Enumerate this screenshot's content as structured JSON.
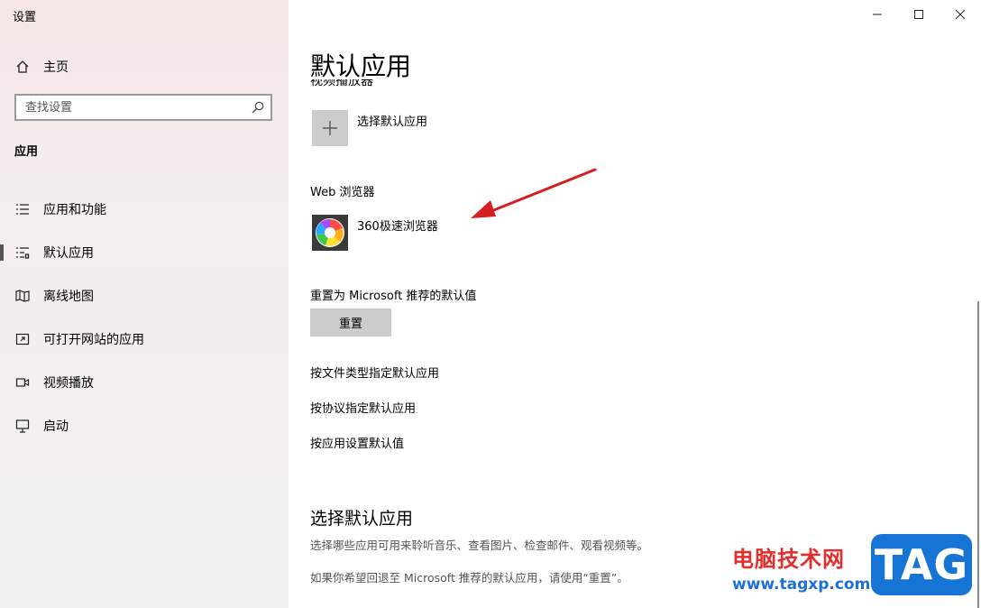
{
  "app": {
    "title": "设置"
  },
  "sidebar": {
    "home_label": "主页",
    "search_placeholder": "查找设置",
    "section_heading": "应用",
    "items": [
      {
        "label": "应用和功能",
        "icon": "list-icon"
      },
      {
        "label": "默认应用",
        "icon": "default-apps-icon",
        "selected": true
      },
      {
        "label": "离线地图",
        "icon": "map-icon"
      },
      {
        "label": "可打开网站的应用",
        "icon": "open-website-icon"
      },
      {
        "label": "视频播放",
        "icon": "video-icon"
      },
      {
        "label": "启动",
        "icon": "startup-icon"
      }
    ]
  },
  "main": {
    "title": "默认应用",
    "clipped_category": "视频播放器",
    "video_player_app": "选择默认应用",
    "web_browser_label": "Web 浏览器",
    "web_browser_app": "360极速浏览器",
    "reset_label": "重置为 Microsoft 推荐的默认值",
    "reset_button": "重置",
    "links": [
      "按文件类型指定默认应用",
      "按协议指定默认应用",
      "按应用设置默认值"
    ],
    "section2_title": "选择默认应用",
    "section2_desc1": "选择哪些应用可用来聆听音乐、查看图片、检查邮件、观看视频等。",
    "section2_desc2": "如果你希望回退至 Microsoft 推荐的默认应用，请使用“重置”。"
  },
  "watermark": {
    "text": "电脑技术网",
    "url": "www.tagxp.com",
    "logo": "TAG"
  },
  "colors": {
    "arrow": "#d42020",
    "watermark_red": "#e0302c",
    "watermark_blue": "#1e6fd9",
    "logo_bg": "#1574d4"
  }
}
